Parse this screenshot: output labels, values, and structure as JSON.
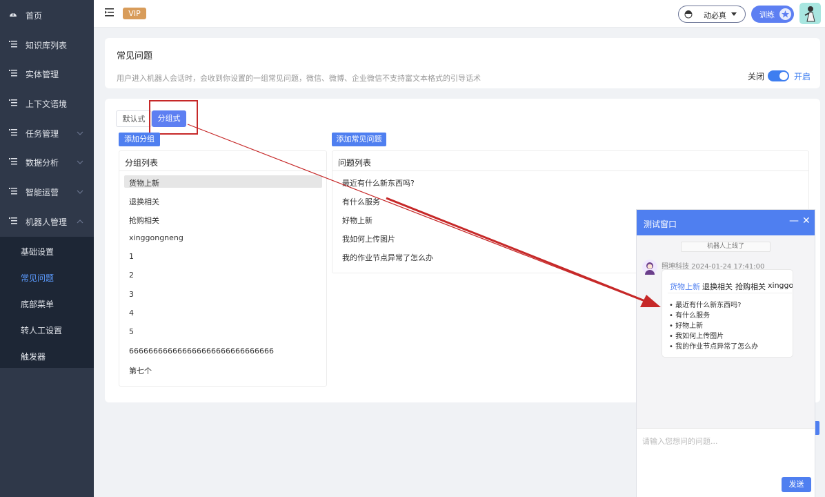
{
  "sidebar": {
    "items": [
      {
        "label": "首页",
        "icon": "dashboard-icon"
      },
      {
        "label": "知识库列表",
        "icon": "list-icon"
      },
      {
        "label": "实体管理",
        "icon": "list-icon"
      },
      {
        "label": "上下文语境",
        "icon": "list-icon"
      },
      {
        "label": "任务管理",
        "icon": "list-icon",
        "expandable": true
      },
      {
        "label": "数据分析",
        "icon": "list-icon",
        "expandable": true
      },
      {
        "label": "智能运营",
        "icon": "list-icon",
        "expandable": true
      },
      {
        "label": "机器人管理",
        "icon": "list-icon",
        "expandable": true,
        "expanded": true
      }
    ],
    "submenu": [
      "基础设置",
      "常见问题",
      "底部菜单",
      "转人工设置",
      "触发器"
    ],
    "active_submenu": "常见问题"
  },
  "topbar": {
    "vip_label": "VIP",
    "user_name": "动必真",
    "train_label": "训练"
  },
  "faq_header": {
    "title": "常见问题",
    "description": "用户进入机器人会话时，会收到你设置的一组常见问题，微信、微博、企业微信不支持富文本格式的引导话术",
    "toggle_off_label": "关闭",
    "toggle_on_label": "开启",
    "toggle_state": "on"
  },
  "main": {
    "tabs": [
      "默认式",
      "分组式"
    ],
    "active_tab": "分组式",
    "add_group_label": "添加分组",
    "add_faq_label": "添加常见问题",
    "group_panel_title": "分组列表",
    "groups": [
      "货物上新",
      "退换相关",
      "抢购相关",
      "xinggongneng",
      "1",
      "2",
      "3",
      "4",
      "5",
      "666666666666666666666666666666",
      "第七个"
    ],
    "active_group": "货物上新",
    "faq_panel_title": "问题列表",
    "faqs": [
      "最近有什么新东西吗?",
      "有什么服务",
      "好物上新",
      "我如何上传图片",
      "我的作业节点异常了怎么办"
    ]
  },
  "chat": {
    "title": "测试窗口",
    "system_notice": "机器人上线了",
    "sender": "照坤科技 2024-01-24 17:41:00",
    "bubble_tabs": [
      "货物上新",
      "退换相关",
      "抢购相关",
      "xinggong"
    ],
    "bubble_questions": [
      "最近有什么新东西吗?",
      "有什么服务",
      "好物上新",
      "我如何上传图片",
      "我的作业节点异常了怎么办"
    ],
    "input_placeholder": "请输入您想问的问题...",
    "send_label": "发送"
  },
  "colors": {
    "accent": "#4f7ff0",
    "sidebar_bg": "#2f3849",
    "annotation_red": "#c62828",
    "vip": "#d89c5a"
  }
}
